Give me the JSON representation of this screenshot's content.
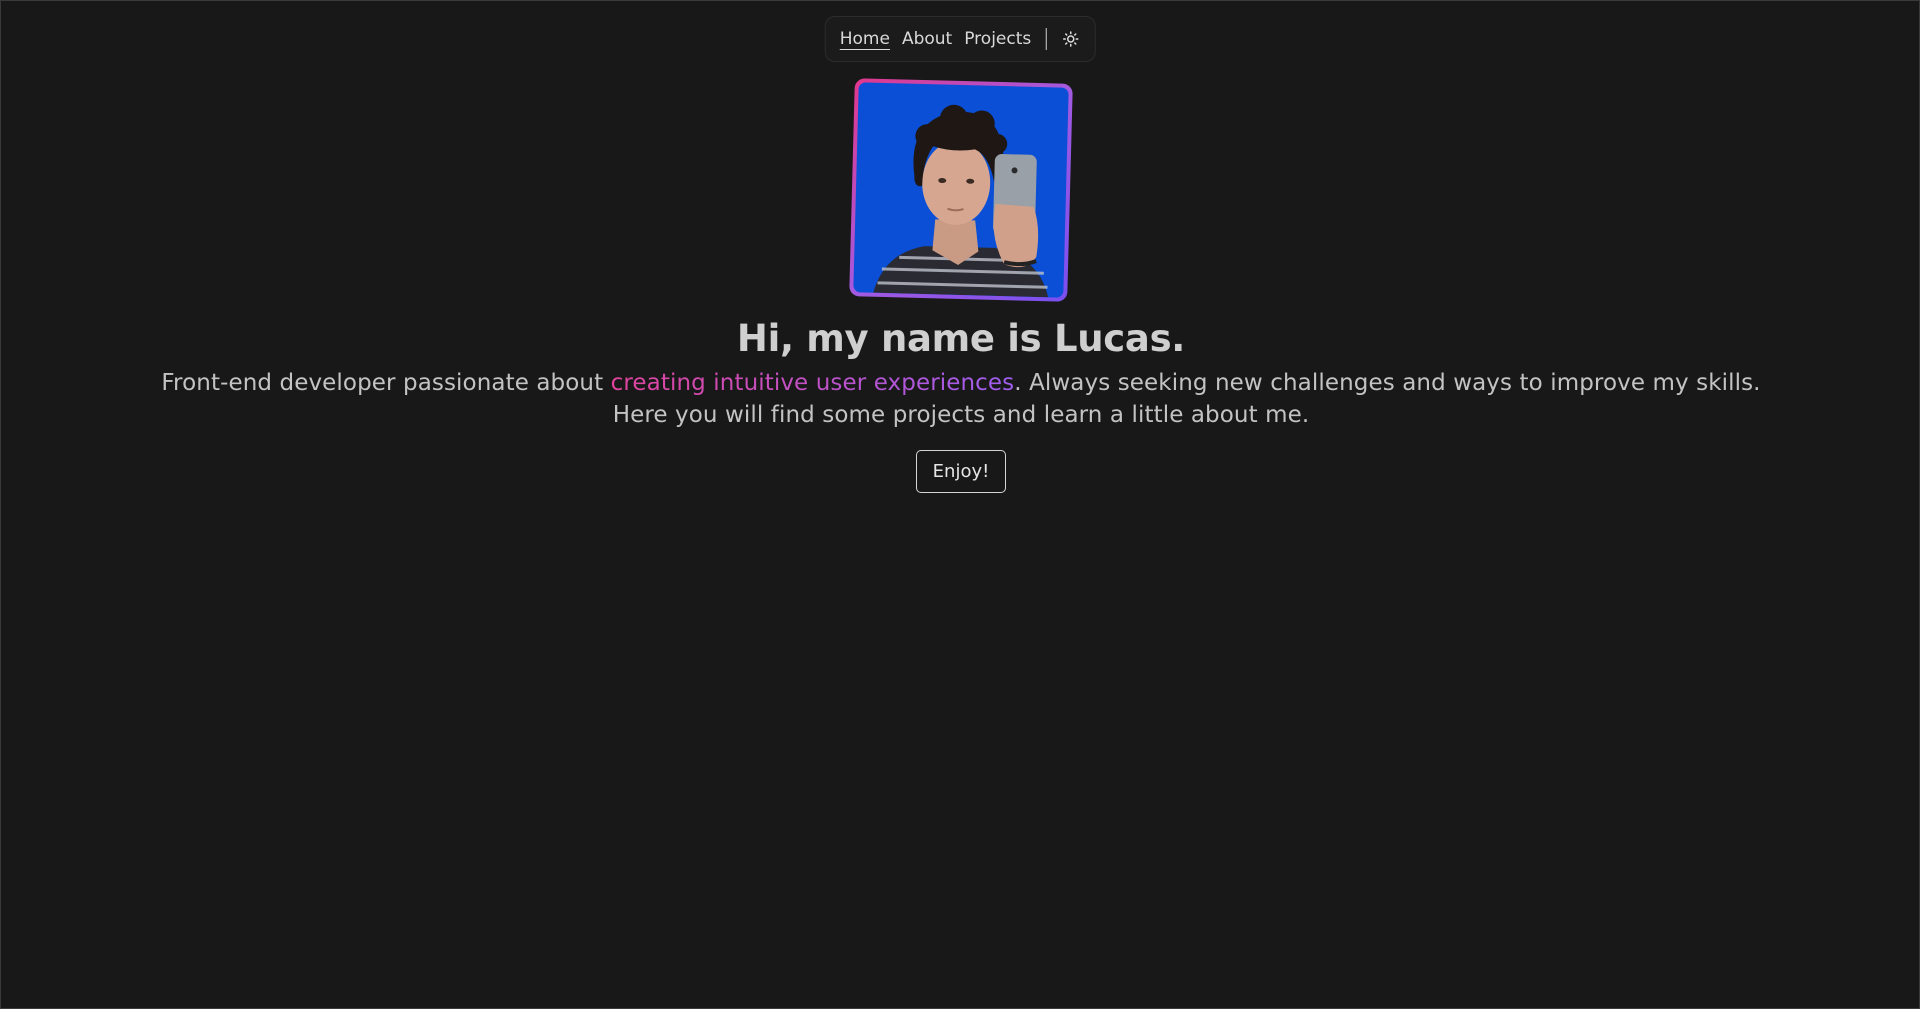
{
  "nav": {
    "items": [
      {
        "label": "Home",
        "active": true
      },
      {
        "label": "About",
        "active": false
      },
      {
        "label": "Projects",
        "active": false
      }
    ],
    "theme_icon": "sun-icon"
  },
  "avatar": {
    "background_color": "#0a4fd6",
    "border_gradient": [
      "#e0388c",
      "#a35ae0",
      "#7a4ff0"
    ]
  },
  "hero": {
    "heading": "Hi, my name is Lucas.",
    "intro_before": "Front-end developer passionate about ",
    "intro_highlight": "creating intuitive user experiences",
    "intro_after": ". Always seeking new challenges and ways to improve my skills.",
    "line2": "Here you will find some projects and learn a little about me.",
    "button_label": "Enjoy!"
  },
  "colors": {
    "background": "#181818",
    "highlight_gradient": [
      "#e0449c",
      "#9f5ef0"
    ]
  }
}
